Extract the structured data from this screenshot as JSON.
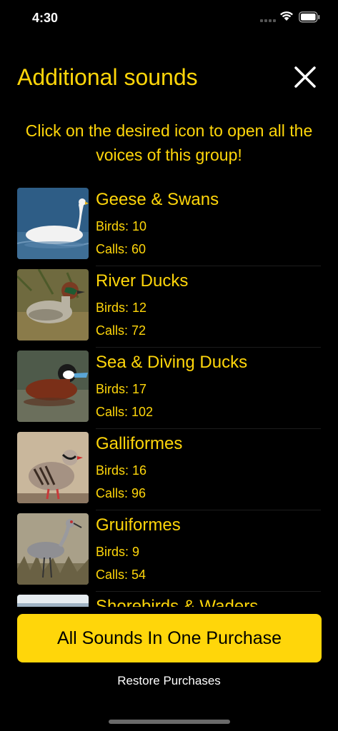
{
  "status_bar": {
    "time": "4:30"
  },
  "header": {
    "title": "Additional sounds",
    "close_icon": "close-icon"
  },
  "subtitle": "Click on the desired icon to open all the voices of this group!",
  "groups": [
    {
      "name": "Geese & Swans",
      "birds": "Birds: 10",
      "calls": "Calls: 60",
      "image": "swan"
    },
    {
      "name": "River Ducks",
      "birds": "Birds: 12",
      "calls": "Calls: 72",
      "image": "teal-duck"
    },
    {
      "name": "Sea & Diving Ducks",
      "birds": "Birds: 17",
      "calls": "Calls: 102",
      "image": "ruddy-duck"
    },
    {
      "name": "Galliformes",
      "birds": "Birds: 16",
      "calls": "Calls: 96",
      "image": "partridge"
    },
    {
      "name": "Gruiformes",
      "birds": "Birds: 9",
      "calls": "Calls: 54",
      "image": "crane"
    },
    {
      "name": "Shorebirds & Waders",
      "birds": "",
      "calls": "",
      "image": "wader"
    }
  ],
  "purchase_all_label": "All Sounds In One Purchase",
  "restore_label": "Restore Purchases",
  "colors": {
    "accent": "#FFD60A",
    "background": "#000000"
  }
}
